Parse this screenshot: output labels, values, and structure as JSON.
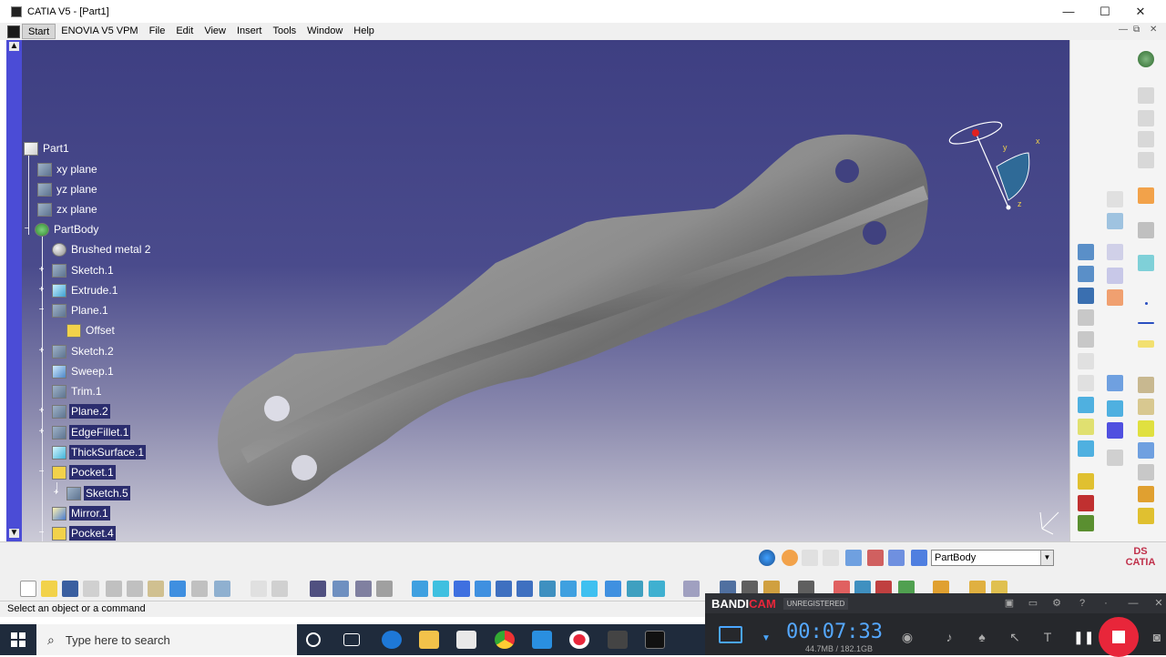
{
  "window": {
    "title": "CATIA V5 - [Part1]",
    "minimize": "—",
    "maximize": "☐",
    "close": "✕"
  },
  "menu": {
    "items": [
      "Start",
      "ENOVIA V5 VPM",
      "File",
      "Edit",
      "View",
      "Insert",
      "Tools",
      "Window",
      "Help"
    ],
    "mdi_minimize": "—",
    "mdi_restore": "⧉",
    "mdi_close": "✕"
  },
  "tree": {
    "nodes": [
      {
        "label": "Part1",
        "icon": "part-icon"
      },
      {
        "label": "xy plane",
        "icon": "plane-icon"
      },
      {
        "label": "yz plane",
        "icon": "plane-icon"
      },
      {
        "label": "zx plane",
        "icon": "plane-icon"
      },
      {
        "label": "PartBody",
        "icon": "body-gear-icon"
      },
      {
        "label": "Brushed metal 2",
        "icon": "material-sphere-icon"
      },
      {
        "label": "Sketch.1",
        "icon": "sketch-icon"
      },
      {
        "label": "Extrude.1",
        "icon": "extrude-icon"
      },
      {
        "label": "Plane.1",
        "icon": "plane-icon"
      },
      {
        "label": "Offset",
        "icon": "parameter-icon"
      },
      {
        "label": "Sketch.2",
        "icon": "sketch-icon"
      },
      {
        "label": "Sweep.1",
        "icon": "sweep-icon"
      },
      {
        "label": "Trim.1",
        "icon": "trim-icon"
      },
      {
        "label": "Plane.2",
        "icon": "plane-icon"
      },
      {
        "label": "EdgeFillet.1",
        "icon": "fillet-icon"
      },
      {
        "label": "ThickSurface.1",
        "icon": "thick-surface-icon"
      },
      {
        "label": "Pocket.1",
        "icon": "pocket-icon"
      },
      {
        "label": "Sketch.5",
        "icon": "sketch-icon"
      },
      {
        "label": "Mirror.1",
        "icon": "mirror-icon"
      },
      {
        "label": "Pocket.4",
        "icon": "pocket-icon"
      }
    ]
  },
  "compass": {
    "x": "x",
    "y": "y",
    "z": "z"
  },
  "bottom": {
    "current_body": "PartBody",
    "brand": "CATIA"
  },
  "status": {
    "text": "Select an object or a command"
  },
  "bandicam": {
    "logo_a": "BANDI",
    "logo_b": "CAM",
    "badge": "UNREGISTERED",
    "time": "00:07:33",
    "size": "44.7MB / 182.1GB"
  },
  "taskbar": {
    "search_placeholder": "Type here to search"
  },
  "colors": {
    "viewport_top": "#3e3f82",
    "viewport_bottom": "#cccbd7",
    "tree_bar": "#4b4cd6",
    "bandicam_time": "#55a8ff",
    "record": "#e8263a"
  }
}
